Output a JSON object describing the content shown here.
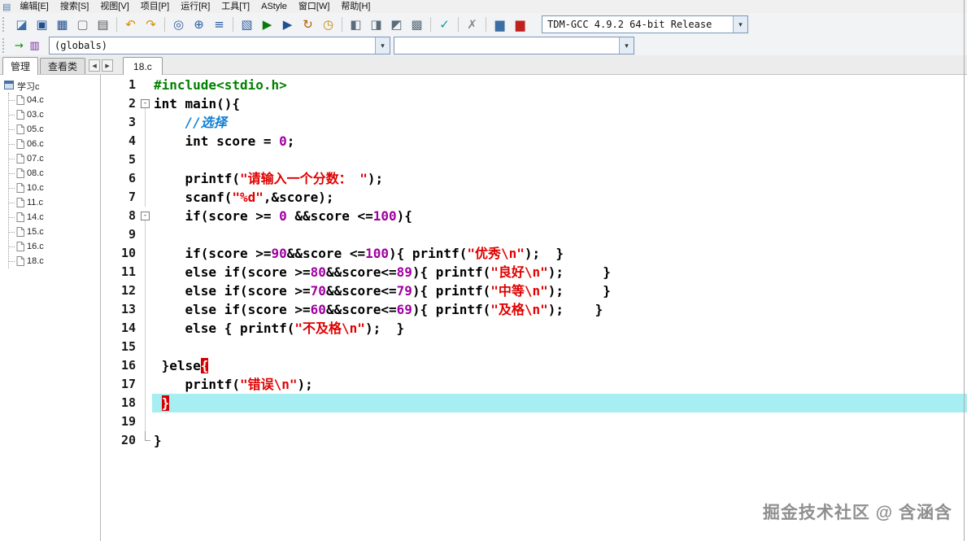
{
  "colors": {
    "str": "#e00000",
    "num": "#a000a0",
    "com": "#0f7fd4",
    "pre": "#008000",
    "curbg": "#a6eef2",
    "bracebg": "#d40000",
    "bracefg": "#ffffff"
  },
  "menu": {
    "app_icon": "▤",
    "items": [
      "编辑[E]",
      "搜索[S]",
      "视图[V]",
      "项目[P]",
      "运行[R]",
      "工具[T]",
      "AStyle",
      "窗口[W]",
      "帮助[H]"
    ]
  },
  "toolbar1": {
    "compiler": "TDM-GCC 4.9.2 64-bit Release",
    "compiler_arrow": "▾",
    "buttons": [
      {
        "name": "open-file-icon",
        "glyph": "◪",
        "color": "#3a6ea5"
      },
      {
        "name": "save-icon",
        "glyph": "▣",
        "color": "#1f4f8f"
      },
      {
        "name": "save-all-icon",
        "glyph": "▦",
        "color": "#1f4f8f"
      },
      {
        "name": "close-file-icon",
        "glyph": "▢",
        "color": "#707070"
      },
      {
        "name": "print-icon",
        "glyph": "▤",
        "color": "#555555"
      },
      {
        "name": "undo-icon",
        "glyph": "↶",
        "color": "#d98e00",
        "sep": true
      },
      {
        "name": "redo-icon",
        "glyph": "↷",
        "color": "#d98e00"
      },
      {
        "name": "find-icon",
        "glyph": "◎",
        "color": "#2f5fa0",
        "sep": true
      },
      {
        "name": "replace-icon",
        "glyph": "⊕",
        "color": "#2f5fa0"
      },
      {
        "name": "goto-line-icon",
        "glyph": "≡",
        "color": "#2f5fa0"
      },
      {
        "name": "compile-icon",
        "glyph": "▧",
        "color": "#2f5fa0",
        "sep": true
      },
      {
        "name": "run-icon",
        "glyph": "▶",
        "color": "#0a7a0a"
      },
      {
        "name": "compile-run-icon",
        "glyph": "▶",
        "color": "#1f4f8f"
      },
      {
        "name": "rebuild-icon",
        "glyph": "↻",
        "color": "#b06000"
      },
      {
        "name": "profile-clock-icon",
        "glyph": "◷",
        "color": "#c08800"
      },
      {
        "name": "window-layout-1-icon",
        "glyph": "◧",
        "color": "#5a6b7a",
        "sep": true
      },
      {
        "name": "window-layout-2-icon",
        "glyph": "◨",
        "color": "#5a6b7a"
      },
      {
        "name": "window-layout-3-icon",
        "glyph": "◩",
        "color": "#5a6b7a"
      },
      {
        "name": "window-layout-4-icon",
        "glyph": "▩",
        "color": "#5a6b7a"
      },
      {
        "name": "syntax-check-icon",
        "glyph": "✓",
        "color": "#0a9a9a",
        "sep": true
      },
      {
        "name": "abort-icon",
        "glyph": "✗",
        "color": "#8a8a8a",
        "sep": true
      },
      {
        "name": "profile-chart-icon",
        "glyph": "▆",
        "color": "#3a6ea5",
        "sep": true
      },
      {
        "name": "delete-profile-icon",
        "glyph": "▆",
        "color": "#c02020"
      }
    ]
  },
  "toolbar2": {
    "globals": "(globals)",
    "members": "",
    "arrow": "▾",
    "buttons": [
      {
        "name": "goto-definition-icon",
        "glyph": "→",
        "color": "#0a8a0a"
      },
      {
        "name": "class-browser-icon",
        "glyph": "▥",
        "color": "#7a2fa0"
      }
    ]
  },
  "sidebar": {
    "tabs": [
      {
        "label": "管理",
        "active": true
      },
      {
        "label": "查看类",
        "active": false
      }
    ],
    "scroll_left": "◀",
    "scroll_right": "▶",
    "tree": {
      "root": "学习c",
      "files": [
        "04.c",
        "03.c",
        "05.c",
        "06.c",
        "07.c",
        "08.c",
        "10.c",
        "11.c",
        "14.c",
        "15.c",
        "16.c",
        "18.c"
      ]
    }
  },
  "editor": {
    "tab": "18.c",
    "current_line": 18,
    "lines": [
      {
        "n": 1,
        "fold": "",
        "segs": [
          [
            "pre",
            "#include<stdio.h>"
          ]
        ]
      },
      {
        "n": 2,
        "fold": "box",
        "segs": [
          [
            "k",
            "int"
          ],
          [
            "p",
            " main(){"
          ]
        ]
      },
      {
        "n": 3,
        "fold": "l",
        "segs": [
          [
            "p",
            "    "
          ],
          [
            "c",
            "//选择"
          ]
        ]
      },
      {
        "n": 4,
        "fold": "l",
        "segs": [
          [
            "p",
            "    "
          ],
          [
            "k",
            "int"
          ],
          [
            "p",
            " score = "
          ],
          [
            "n",
            "0"
          ],
          [
            "p",
            ";"
          ]
        ]
      },
      {
        "n": 5,
        "fold": "l",
        "segs": []
      },
      {
        "n": 6,
        "fold": "l",
        "segs": [
          [
            "p",
            "    printf("
          ],
          [
            "s",
            "\"请输入一个分数： \""
          ],
          [
            "p",
            ");"
          ]
        ]
      },
      {
        "n": 7,
        "fold": "l",
        "segs": [
          [
            "p",
            "    scanf("
          ],
          [
            "s",
            "\"%d\""
          ],
          [
            "p",
            ",&score);"
          ]
        ]
      },
      {
        "n": 8,
        "fold": "box",
        "segs": [
          [
            "p",
            "    "
          ],
          [
            "k",
            "if"
          ],
          [
            "p",
            "(score >= "
          ],
          [
            "n",
            "0"
          ],
          [
            "p",
            " &&score <="
          ],
          [
            "n",
            "100"
          ],
          [
            "p",
            "){"
          ]
        ]
      },
      {
        "n": 9,
        "fold": "l",
        "segs": []
      },
      {
        "n": 10,
        "fold": "l",
        "segs": [
          [
            "p",
            "    "
          ],
          [
            "k",
            "if"
          ],
          [
            "p",
            "(score >="
          ],
          [
            "n",
            "90"
          ],
          [
            "p",
            "&&score <="
          ],
          [
            "n",
            "100"
          ],
          [
            "p",
            "){ printf("
          ],
          [
            "s",
            "\"优秀\\n\""
          ],
          [
            "p",
            ");  }"
          ]
        ]
      },
      {
        "n": 11,
        "fold": "l",
        "segs": [
          [
            "p",
            "    "
          ],
          [
            "k",
            "else"
          ],
          [
            "p",
            " "
          ],
          [
            "k",
            "if"
          ],
          [
            "p",
            "(score >="
          ],
          [
            "n",
            "80"
          ],
          [
            "p",
            "&&score<="
          ],
          [
            "n",
            "89"
          ],
          [
            "p",
            "){ printf("
          ],
          [
            "s",
            "\"良好\\n\""
          ],
          [
            "p",
            ");     }"
          ]
        ]
      },
      {
        "n": 12,
        "fold": "l",
        "segs": [
          [
            "p",
            "    "
          ],
          [
            "k",
            "else"
          ],
          [
            "p",
            " "
          ],
          [
            "k",
            "if"
          ],
          [
            "p",
            "(score >="
          ],
          [
            "n",
            "70"
          ],
          [
            "p",
            "&&score<="
          ],
          [
            "n",
            "79"
          ],
          [
            "p",
            "){ printf("
          ],
          [
            "s",
            "\"中等\\n\""
          ],
          [
            "p",
            ");     }"
          ]
        ]
      },
      {
        "n": 13,
        "fold": "l",
        "segs": [
          [
            "p",
            "    "
          ],
          [
            "k",
            "else"
          ],
          [
            "p",
            " "
          ],
          [
            "k",
            "if"
          ],
          [
            "p",
            "(score >="
          ],
          [
            "n",
            "60"
          ],
          [
            "p",
            "&&score<="
          ],
          [
            "n",
            "69"
          ],
          [
            "p",
            "){ printf("
          ],
          [
            "s",
            "\"及格\\n\""
          ],
          [
            "p",
            ");    }"
          ]
        ]
      },
      {
        "n": 14,
        "fold": "l",
        "segs": [
          [
            "p",
            "    "
          ],
          [
            "k",
            "else"
          ],
          [
            "p",
            " { printf("
          ],
          [
            "s",
            "\"不及格\\n\""
          ],
          [
            "p",
            ");  }"
          ]
        ]
      },
      {
        "n": 15,
        "fold": "l",
        "segs": []
      },
      {
        "n": 16,
        "fold": "l",
        "segs": [
          [
            "p",
            " }"
          ],
          [
            "k",
            "else"
          ],
          [
            "bm",
            "{"
          ]
        ]
      },
      {
        "n": 17,
        "fold": "l",
        "segs": [
          [
            "p",
            "    printf("
          ],
          [
            "s",
            "\"错误\\n\""
          ],
          [
            "p",
            ");"
          ]
        ]
      },
      {
        "n": 18,
        "fold": "l",
        "cur": true,
        "segs": [
          [
            "p",
            " "
          ],
          [
            "bm",
            "}"
          ]
        ]
      },
      {
        "n": 19,
        "fold": "l",
        "segs": []
      },
      {
        "n": 20,
        "fold": "corner",
        "segs": [
          [
            "p",
            "}"
          ]
        ]
      }
    ]
  },
  "watermark": "掘金技术社区 @ 含涵含"
}
